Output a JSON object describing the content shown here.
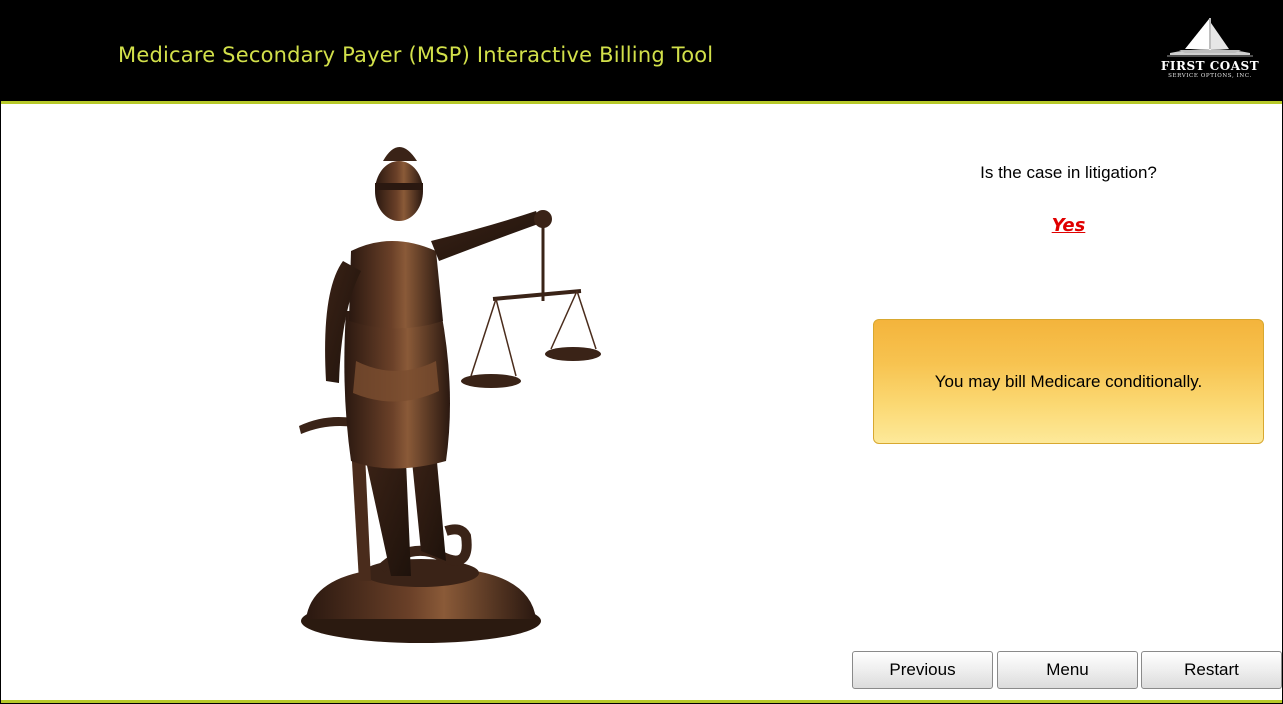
{
  "header": {
    "title": "Medicare Secondary Payer (MSP) Interactive Billing Tool",
    "logo_name": "FIRST COAST",
    "logo_subtitle": "SERVICE OPTIONS, INC."
  },
  "question": {
    "text": "Is the case in litigation?",
    "answer": "Yes"
  },
  "result": {
    "text": "You may bill Medicare conditionally."
  },
  "nav": {
    "previous_label": "Previous",
    "menu_label": "Menu",
    "restart_label": "Restart"
  },
  "colors": {
    "header_bg": "#000000",
    "title_color": "#d2e04a",
    "accent_line": "#b7c92a",
    "answer_color": "#e00000",
    "result_box_top": "#f4b43c",
    "result_box_bottom": "#fde99a"
  },
  "images": {
    "statue": "lady-justice-statue"
  }
}
